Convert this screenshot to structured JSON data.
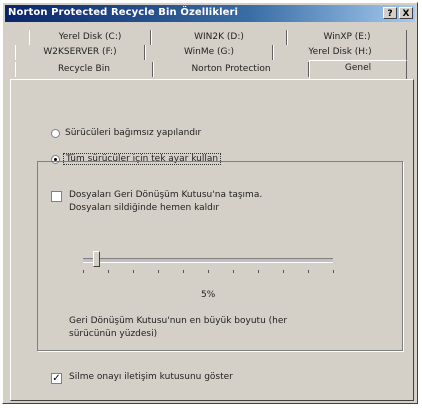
{
  "window": {
    "title": "Norton Protected Recycle Bin Özellikleri",
    "help_button": "?",
    "close_button": "X"
  },
  "tabs": {
    "row1": [
      "Yerel Disk (C:)",
      "WIN2K (D:)",
      "WinXP (E:)"
    ],
    "row2": [
      "W2KSERVER (F:)",
      "WinMe (G:)",
      "Yerel Disk (H:)"
    ],
    "row3": [
      "Recycle Bin",
      "Norton Protection",
      "Genel"
    ],
    "active": "Genel"
  },
  "options": {
    "independent_label": "Sürücüleri bağımsız yapılandır",
    "all_drives_label": "Tüm sürücüler için tek ayar kullan",
    "all_drives_selected": true,
    "no_recycle_label_line1": "Dosyaları Geri Dönüşüm Kutusu'na taşıma.",
    "no_recycle_label_line2": "Dosyaları sildiğinde hemen kaldır",
    "no_recycle_checked": false,
    "max_size_percent": "5%",
    "max_size_value": 0.05,
    "max_size_label_line1": "Geri Dönüşüm Kutusu'nun en büyük boyutu (her",
    "max_size_label_line2": "sürücünün yüzdesi)",
    "confirm_label": "Silme onayı iletişim kutusunu göster",
    "confirm_checked": true
  },
  "icons": {
    "checked_mark": "✓"
  }
}
